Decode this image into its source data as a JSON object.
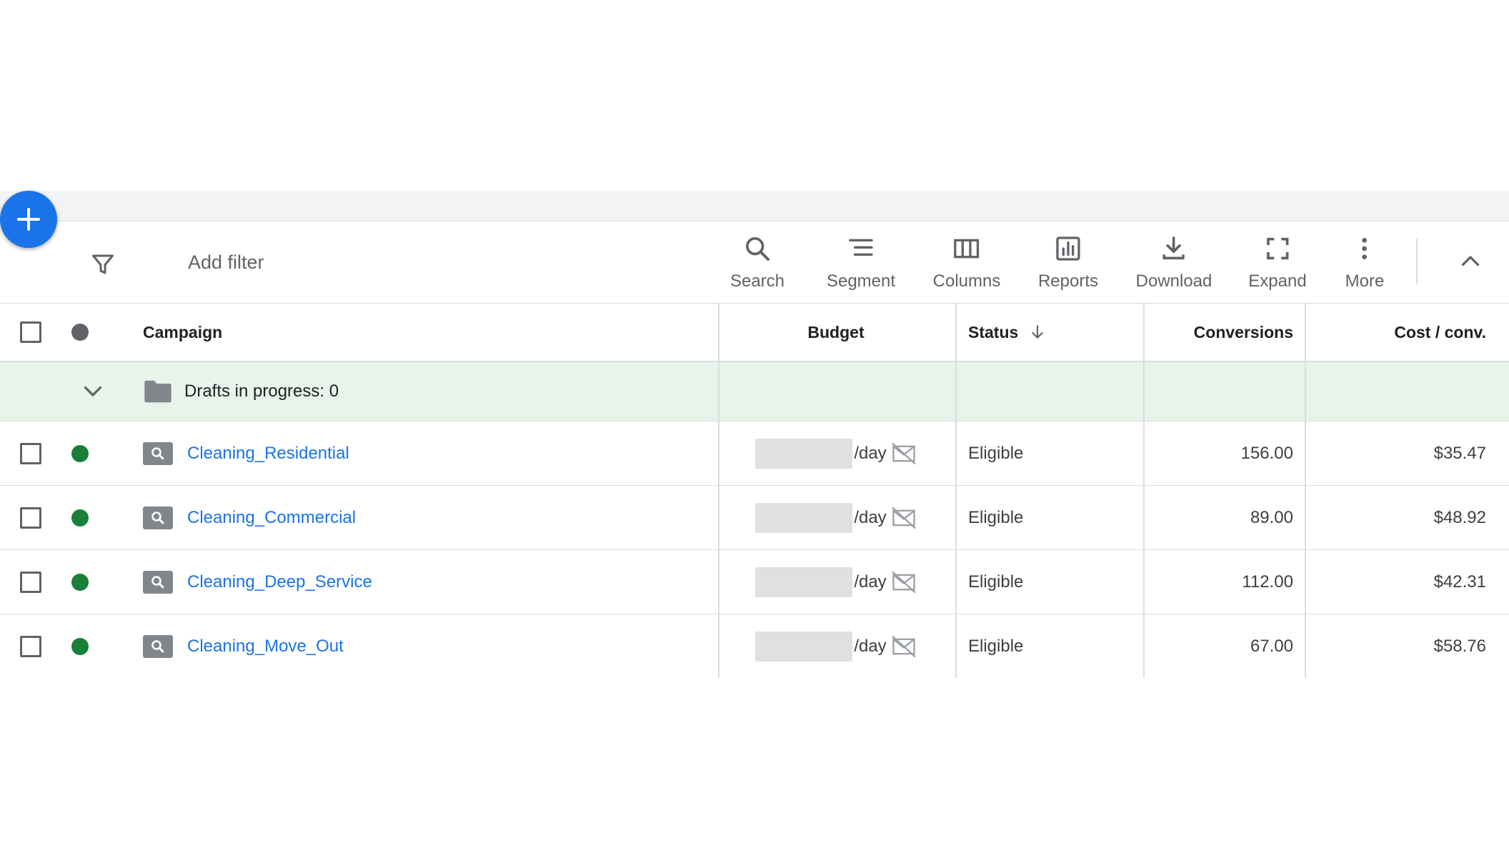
{
  "colors": {
    "accent": "#1a73e8",
    "enabled_dot": "#188038",
    "header_dot": "#5f6368",
    "drafts_bg": "#e6f4ea",
    "icon_grey": "#5f6368"
  },
  "fab": {
    "icon": "plus-icon"
  },
  "toolbar": {
    "add_filter": "Add filter",
    "tools": [
      {
        "icon": "search-icon",
        "label": "Search"
      },
      {
        "icon": "segment-icon",
        "label": "Segment"
      },
      {
        "icon": "columns-icon",
        "label": "Columns"
      },
      {
        "icon": "reports-icon",
        "label": "Reports"
      },
      {
        "icon": "download-icon",
        "label": "Download"
      },
      {
        "icon": "expand-icon",
        "label": "Expand"
      },
      {
        "icon": "more-vert-icon",
        "label": "More"
      }
    ],
    "collapse_icon": "chevron-up-icon"
  },
  "table": {
    "headers": {
      "campaign": "Campaign",
      "budget": "Budget",
      "status": "Status",
      "conversions": "Conversions",
      "cost_per_conv": "Cost / conv."
    },
    "sort": {
      "column": "status",
      "direction": "descending"
    },
    "drafts": {
      "label": "Drafts in progress: 0"
    },
    "rows": [
      {
        "campaign": "Cleaning_Residential",
        "budget_suffix": "/day",
        "status": "Eligible",
        "conversions": "156.00",
        "cost_per_conv": "$35.47"
      },
      {
        "campaign": "Cleaning_Commercial",
        "budget_suffix": "/day",
        "status": "Eligible",
        "conversions": "89.00",
        "cost_per_conv": "$48.92"
      },
      {
        "campaign": "Cleaning_Deep_Service",
        "budget_suffix": "/day",
        "status": "Eligible",
        "conversions": "112.00",
        "cost_per_conv": "$42.31"
      },
      {
        "campaign": "Cleaning_Move_Out",
        "budget_suffix": "/day",
        "status": "Eligible",
        "conversions": "67.00",
        "cost_per_conv": "$58.76"
      }
    ]
  }
}
